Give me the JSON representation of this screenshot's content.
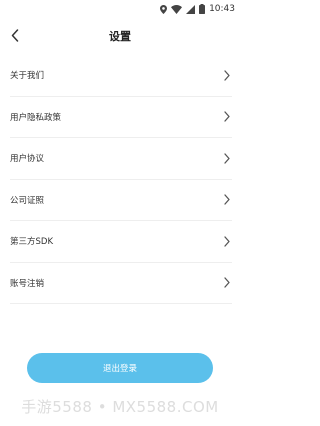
{
  "status_bar": {
    "time": "10:43",
    "icons": [
      "location-icon",
      "wifi-icon",
      "signal-icon",
      "battery-icon"
    ]
  },
  "header": {
    "back_icon": "chevron-left-icon",
    "title": "设置"
  },
  "menu": {
    "items": [
      {
        "label": "关于我们",
        "icon": "chevron-right-icon"
      },
      {
        "label": "用户隐私政策",
        "icon": "chevron-right-icon"
      },
      {
        "label": "用户协议",
        "icon": "chevron-right-icon"
      },
      {
        "label": "公司证照",
        "icon": "chevron-right-icon"
      },
      {
        "label": "第三方SDK",
        "icon": "chevron-right-icon"
      },
      {
        "label": "账号注销",
        "icon": "chevron-right-icon"
      }
    ]
  },
  "footer": {
    "logout_label": "退出登录"
  },
  "watermark": "手游5588 • MX5588.COM",
  "colors": {
    "accent": "#5bc0eb",
    "divider": "#eeeeee",
    "background": "#ffffff"
  }
}
